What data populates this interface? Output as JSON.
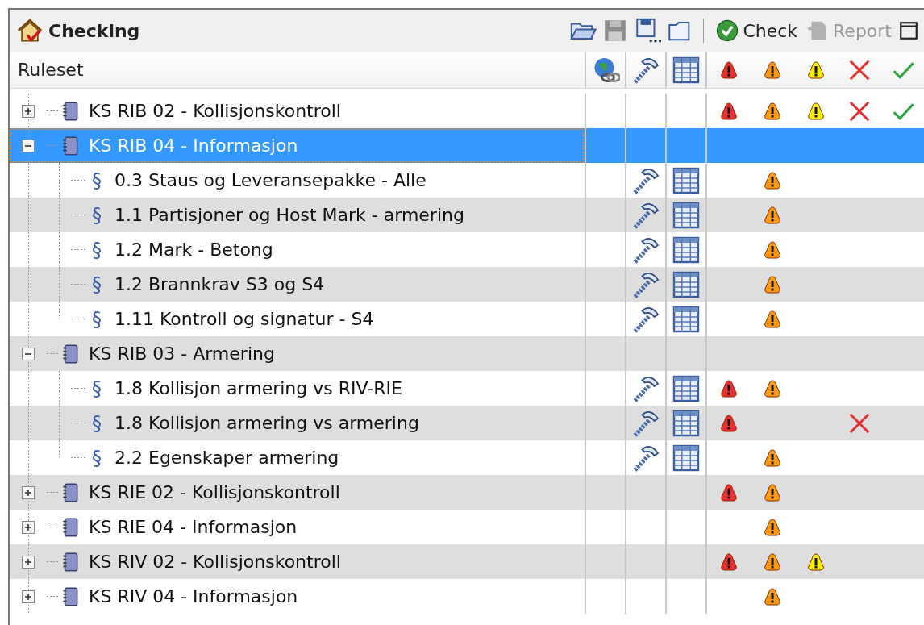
{
  "window": {
    "title": "Checking"
  },
  "toolbar": {
    "icon_buttons": [
      {
        "kind": "open",
        "disabled": false
      },
      {
        "kind": "save",
        "disabled": true
      },
      {
        "kind": "save_as",
        "disabled": false
      },
      {
        "kind": "folder",
        "disabled": false
      }
    ],
    "buttons": [
      {
        "kind": "check",
        "label": "Check",
        "disabled": false
      },
      {
        "kind": "report",
        "label": "Report",
        "disabled": true
      }
    ]
  },
  "table": {
    "columns": [
      {
        "kind": "name",
        "label": "Ruleset"
      },
      {
        "kind": "link"
      },
      {
        "kind": "rule"
      },
      {
        "kind": "table"
      },
      {
        "kind": "critical"
      },
      {
        "kind": "moderate"
      },
      {
        "kind": "low"
      },
      {
        "kind": "rejected"
      },
      {
        "kind": "approved"
      }
    ],
    "rows": [
      {
        "name": "KS RIB 02 - Kollisjonskontroll",
        "expanded": false,
        "selected": false,
        "status": {
          "critical": true,
          "moderate": true,
          "low": true,
          "rejected": true,
          "approved": true
        }
      },
      {
        "name": "KS RIB 04 - Informasjon",
        "expanded": true,
        "selected": true,
        "status": {
          "critical": false,
          "moderate": false,
          "low": false,
          "rejected": false,
          "approved": false
        },
        "children": [
          {
            "icon": "§",
            "name": "0.3 Staus og Leveransepakke - Alle",
            "selected": false,
            "status": {
              "critical": false,
              "moderate": true,
              "low": false,
              "rejected": false,
              "approved": false
            }
          },
          {
            "icon": "§",
            "name": "1.1 Partisjoner og Host Mark - armering",
            "selected": false,
            "status": {
              "critical": false,
              "moderate": true,
              "low": false,
              "rejected": false,
              "approved": false
            }
          },
          {
            "icon": "§",
            "name": "1.2 Mark - Betong",
            "selected": false,
            "status": {
              "critical": false,
              "moderate": true,
              "low": false,
              "rejected": false,
              "approved": false
            }
          },
          {
            "icon": "§",
            "name": "1.2 Brannkrav S3 og S4",
            "selected": false,
            "status": {
              "critical": false,
              "moderate": true,
              "low": false,
              "rejected": false,
              "approved": false
            }
          },
          {
            "icon": "§",
            "name": "1.11 Kontroll og signatur - S4",
            "selected": false,
            "status": {
              "critical": false,
              "moderate": true,
              "low": false,
              "rejected": false,
              "approved": false
            }
          }
        ]
      },
      {
        "name": "KS RIB 03 - Armering",
        "expanded": true,
        "selected": false,
        "status": {
          "critical": false,
          "moderate": false,
          "low": false,
          "rejected": false,
          "approved": false
        },
        "children": [
          {
            "icon": "§",
            "name": "1.8 Kollisjon armering vs RIV-RIE",
            "selected": false,
            "status": {
              "critical": true,
              "moderate": true,
              "low": false,
              "rejected": false,
              "approved": false
            }
          },
          {
            "icon": "§",
            "name": "1.8 Kollisjon armering vs armering",
            "selected": false,
            "status": {
              "critical": true,
              "moderate": false,
              "low": false,
              "rejected": true,
              "approved": false
            }
          },
          {
            "icon": "§",
            "name": "2.2 Egenskaper armering",
            "selected": false,
            "status": {
              "critical": false,
              "moderate": true,
              "low": false,
              "rejected": false,
              "approved": false
            }
          }
        ]
      },
      {
        "name": "KS RIE 02 - Kollisjonskontroll",
        "expanded": false,
        "selected": false,
        "status": {
          "critical": true,
          "moderate": true,
          "low": false,
          "rejected": false,
          "approved": false
        }
      },
      {
        "name": "KS RIE 04 - Informasjon",
        "expanded": false,
        "selected": false,
        "status": {
          "critical": false,
          "moderate": true,
          "low": false,
          "rejected": false,
          "approved": false
        }
      },
      {
        "name": "KS RIV 02 - Kollisjonskontroll",
        "expanded": false,
        "selected": false,
        "status": {
          "critical": true,
          "moderate": true,
          "low": true,
          "rejected": false,
          "approved": false
        }
      },
      {
        "name": "KS RIV 04 - Informasjon",
        "expanded": false,
        "selected": false,
        "status": {
          "critical": false,
          "moderate": true,
          "low": false,
          "rejected": false,
          "approved": false
        }
      }
    ]
  }
}
